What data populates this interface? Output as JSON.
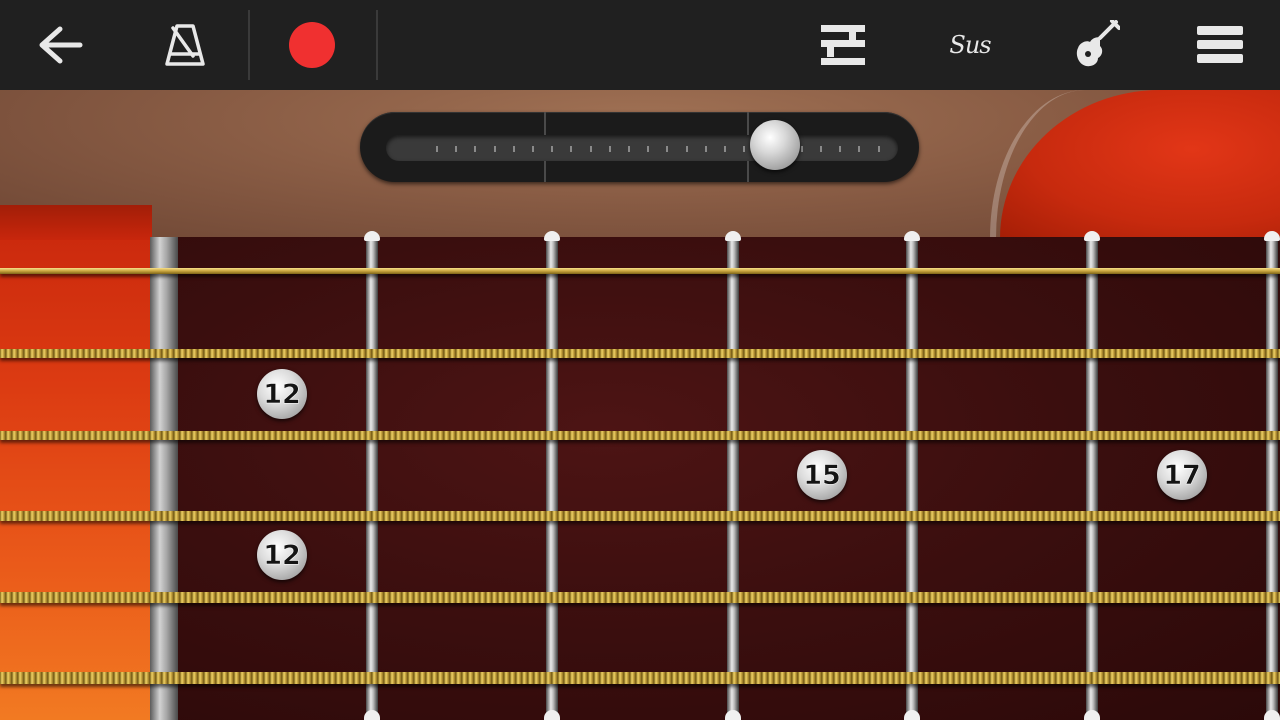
{
  "toolbar": {
    "back_icon": "back-arrow-icon",
    "metronome_icon": "metronome-icon",
    "record_icon": "record-icon",
    "record_color": "#f03030",
    "chords_icon": "chord-grid-icon",
    "sus_label": "Sus",
    "instrument_icon": "guitar-icon",
    "menu_icon": "hamburger-menu-icon"
  },
  "neck_slider": {
    "position_fraction": 0.76
  },
  "fretboard": {
    "string_count": 6,
    "fret_markers": [
      {
        "label": "12"
      },
      {
        "label": "12"
      },
      {
        "label": "15"
      },
      {
        "label": "17"
      }
    ]
  },
  "colors": {
    "toolbar_bg": "#202020",
    "fretboard": "#3a0e0e",
    "string_gold": "#d8b84a",
    "accent_red": "#d63414"
  }
}
